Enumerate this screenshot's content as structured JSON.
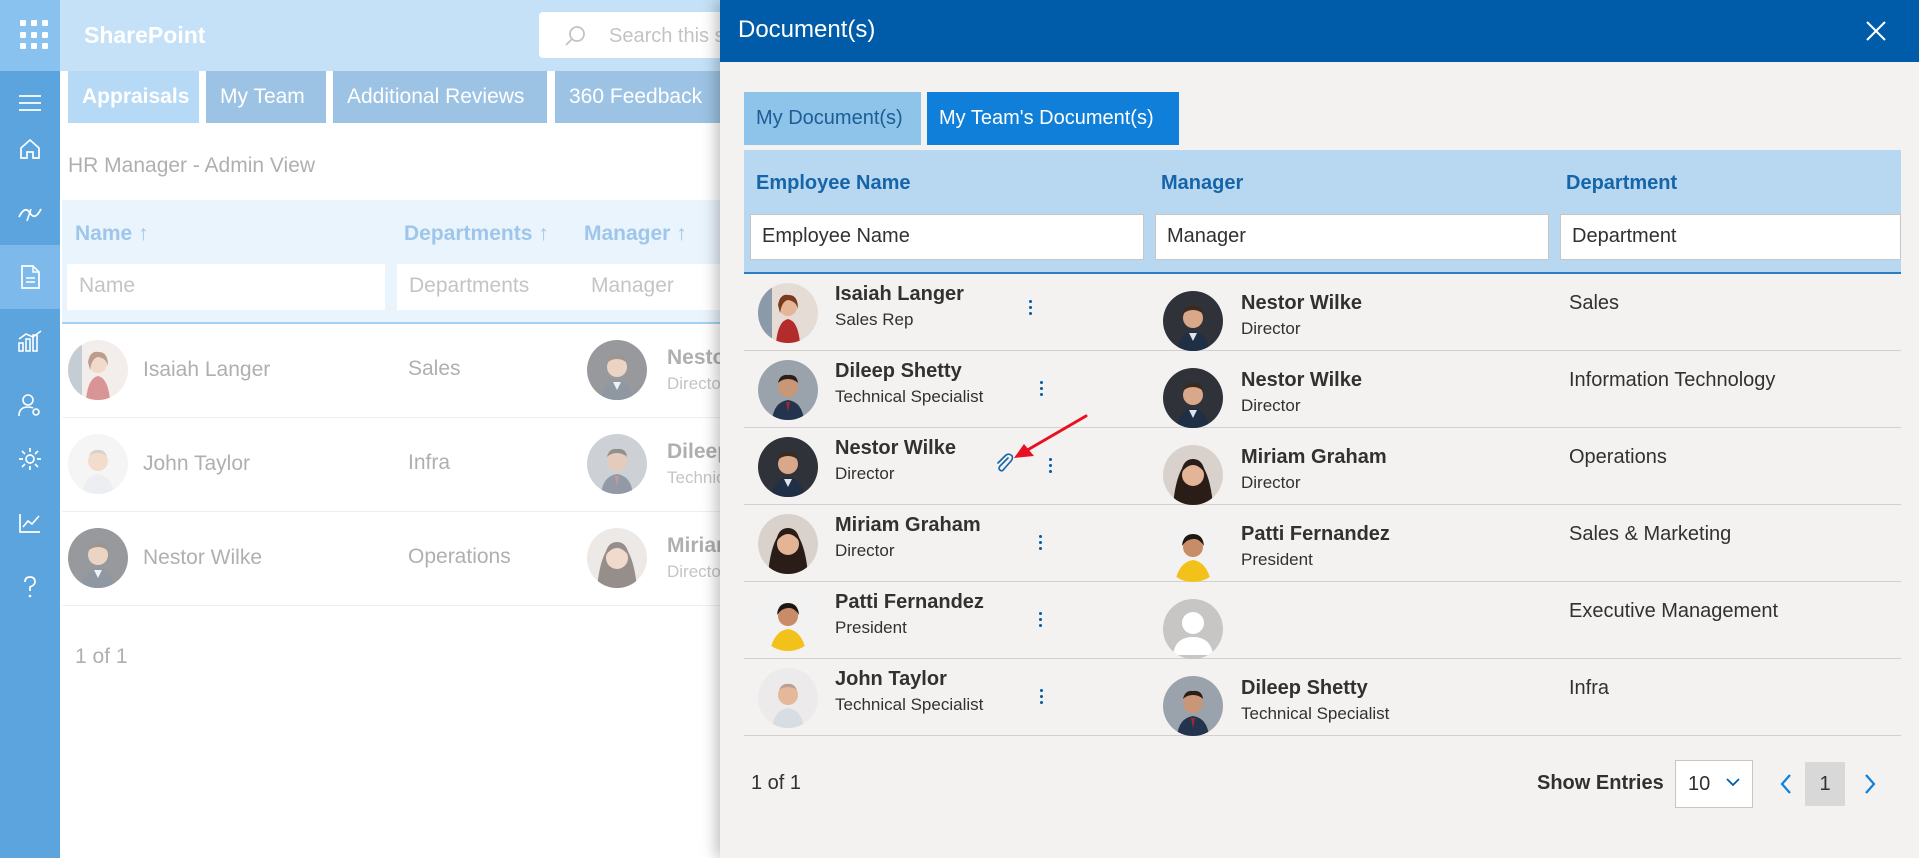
{
  "app": {
    "brand": "SharePoint",
    "search_placeholder": "Search this s"
  },
  "nav_tabs": [
    "Appraisals",
    "My Team",
    "Additional Reviews",
    "360 Feedback"
  ],
  "admin_view": {
    "title": "HR Manager - Admin View",
    "columns": [
      "Name ↑",
      "Departments ↑",
      "Manager ↑"
    ],
    "filters": [
      "Name",
      "Departments",
      "Manager"
    ],
    "rows": [
      {
        "name": "Isaiah Langer",
        "department": "Sales",
        "manager": "Nesto",
        "manager_role": "Directo"
      },
      {
        "name": "John Taylor",
        "department": "Infra",
        "manager": "Dileep",
        "manager_role": "Technic"
      },
      {
        "name": "Nestor Wilke",
        "department": "Operations",
        "manager": "Miriam",
        "manager_role": "Directo"
      }
    ],
    "pager": "1 of 1"
  },
  "panel": {
    "title": "Document(s)",
    "tabs": [
      {
        "label": "My Document(s)",
        "active": false
      },
      {
        "label": "My Team's Document(s)",
        "active": true
      }
    ],
    "columns": [
      "Employee Name",
      "Manager",
      "Department"
    ],
    "filters": [
      "Employee Name",
      "Manager",
      "Department"
    ],
    "rows": [
      {
        "employee": "Isaiah Langer",
        "employee_role": "Sales Rep",
        "manager": "Nestor Wilke",
        "manager_role": "Director",
        "department": "Sales"
      },
      {
        "employee": "Dileep Shetty",
        "employee_role": "Technical Specialist",
        "manager": "Nestor Wilke",
        "manager_role": "Director",
        "department": "Information Technology"
      },
      {
        "employee": "Nestor Wilke",
        "employee_role": "Director",
        "manager": "Miriam Graham",
        "manager_role": "Director",
        "department": "Operations",
        "has_attachment": true
      },
      {
        "employee": "Miriam Graham",
        "employee_role": "Director",
        "manager": "Patti Fernandez",
        "manager_role": "President",
        "department": "Sales & Marketing"
      },
      {
        "employee": "Patti Fernandez",
        "employee_role": "President",
        "manager": "",
        "manager_role": "",
        "department": "Executive Management"
      },
      {
        "employee": "John Taylor",
        "employee_role": "Technical Specialist",
        "manager": "Dileep Shetty",
        "manager_role": "Technical Specialist",
        "department": "Infra"
      }
    ],
    "footer": {
      "count": "1 of 1",
      "show_entries_label": "Show Entries",
      "entries_value": "10",
      "current_page": "1"
    }
  },
  "colors": {
    "header_blue": "#005ca8",
    "active_tab": "#0f7fd9",
    "suite_bar": "#62aeea",
    "annotation_arrow": "#e81123"
  }
}
